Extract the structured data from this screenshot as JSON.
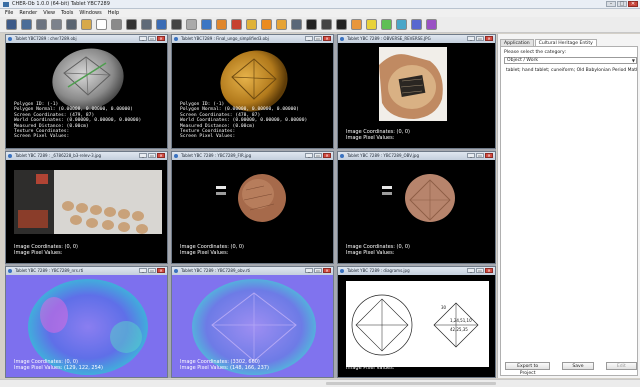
{
  "window": {
    "title": "CHER-Ob 1.0.0 (64-bit) Tablet YBC7289",
    "controls": [
      "–",
      "□",
      "✕"
    ]
  },
  "menubar": [
    "File",
    "Render",
    "View",
    "Tools",
    "Windows",
    "Help"
  ],
  "toolbar": {
    "icons": [
      {
        "name": "open-project-icon",
        "color": "#3d5a88"
      },
      {
        "name": "save-project-icon",
        "color": "#4b6d98"
      },
      {
        "name": "import-object-icon",
        "color": "#6b7380"
      },
      {
        "name": "remove-object-icon",
        "color": "#7c828c"
      },
      {
        "name": "screenshot-icon",
        "color": "#5a6470"
      },
      {
        "name": "folder-icon",
        "color": "#d7a94a"
      },
      {
        "name": "grid-icon",
        "color": "#ffffff"
      },
      {
        "name": "interpolation-icon",
        "color": "#8a8a8a"
      },
      {
        "name": "texture-icon",
        "color": "#333333"
      },
      {
        "name": "cube-icon",
        "color": "#5f6a78"
      },
      {
        "name": "info-icon",
        "color": "#3b6cb5"
      },
      {
        "name": "point-icon",
        "color": "#444444"
      },
      {
        "name": "surface-icon",
        "color": "#aaaaaa"
      },
      {
        "name": "polygon-icon",
        "color": "#3a76c4"
      },
      {
        "name": "pencil-icon",
        "color": "#e0862c"
      },
      {
        "name": "distance-icon",
        "color": "#c7402f"
      },
      {
        "name": "brightness-icon",
        "color": "#e0b238"
      },
      {
        "name": "star-icon",
        "color": "#ec8b1f"
      },
      {
        "name": "note-icon",
        "color": "#e6a335"
      },
      {
        "name": "camera-icon",
        "color": "#5a6778"
      },
      {
        "name": "color-mode-icon",
        "color": "#222222"
      },
      {
        "name": "mono-mode-icon",
        "color": "#444444"
      },
      {
        "name": "rti-icon",
        "color": "#222222"
      },
      {
        "name": "filter-red-icon",
        "color": "#e9963a"
      },
      {
        "name": "filter-yellow-icon",
        "color": "#e8d23a"
      },
      {
        "name": "filter-green-icon",
        "color": "#5fbf55"
      },
      {
        "name": "filter-cyan-icon",
        "color": "#49a6c9"
      },
      {
        "name": "filter-blue-icon",
        "color": "#5767d0"
      },
      {
        "name": "filter-purple-icon",
        "color": "#9a52c4"
      }
    ]
  },
  "panes": [
    {
      "title": "Tablet YBC7289 : cher7289.obj",
      "controls": [
        "_",
        "▭",
        "✕"
      ],
      "info": "Polygon ID: (-1)\nPolygon Normal: (0.00000, 0.00000, 0.00000)\nScreen Coordinates: (479, 87)\nWorld Coordinates: (0.00000, 0.00000, 0.00000)\nMeasured Distance: (0.00cm)\nTexture Coordinates:\nScreen Pixel Values:"
    },
    {
      "title": "Tablet YBC7289 : Final_ungo_simplified3.obj",
      "controls": [
        "_",
        "▭",
        "✕"
      ],
      "info": "Polygon ID: (-1)\nPolygon Normal: (0.00000, 0.00000, 0.00000)\nScreen Coordinates: (478, 87)\nWorld Coordinates: (0.00000, 0.00000, 0.00000)\nMeasured Distance: (0.00cm)\nTexture Coordinates:\nScreen Pixel Values:"
    },
    {
      "title": "Tablet YBC 7289 : OBVERSE_REVERSE.JPG",
      "controls": [
        "_",
        "▭",
        "✕"
      ],
      "info": "Image Coordinates: (0, 0)\nImage Pixel Values:"
    },
    {
      "title": "Tablet YBC 7289 : _6786228_b3-relev-3.jpg",
      "controls": [
        "_",
        "▭",
        "✕"
      ],
      "info": "Image Coordinates: (0, 0)\nImage Pixel Values:"
    },
    {
      "title": "Tablet YBC 7289 : YBC7289_FIR.jpg",
      "controls": [
        "_",
        "▭",
        "✕"
      ],
      "info": "Image Coordinates: (0, 0)\nImage Pixel Values:"
    },
    {
      "title": "Tablet YBC 7289 : YBC7289_OBV.jpg",
      "controls": [
        "_",
        "▭",
        "✕"
      ],
      "info": "Image Coordinates: (0, 0)\nImage Pixel Values:"
    },
    {
      "title": "Tablet YBC 7289 : YBC7289_nrs.rti",
      "controls": [
        "_",
        "▭",
        "✕"
      ],
      "info": "Image Coordinates: (0, 0)\nImage Pixel Values: (129, 122, 254)"
    },
    {
      "title": "Tablet YBC 7289 : YBC7289_obv.rti",
      "controls": [
        "_",
        "▭",
        "✕"
      ],
      "info": "Image Coordinates: (3302, 660)\nImage Pixel Values: (148, 166, 237)"
    },
    {
      "title": "Tablet YBC 7289 : diagrams.jpg",
      "controls": [
        "_",
        "▭",
        "✕"
      ],
      "info": "Image Coordinates: (5, 0)\nImage Pixel Values:"
    }
  ],
  "diagram_text": {
    "left_numbers": [
      "30",
      "1,24,51,10",
      "42,25,35"
    ],
    "right_top": "30",
    "right_mid1": "1,24,51,10",
    "right_mid2": "42,25,35"
  },
  "side_panel": {
    "tabs": [
      "Application",
      "Cultural Heritage Entity"
    ],
    "prompt": "Please select the category:",
    "category": "Object / Work",
    "field_text": "tablet; hand tablet; cuneiform; Old Babylonian Period Mathematical Text",
    "buttons": [
      "Export to Project",
      "Save",
      "Edit"
    ]
  }
}
